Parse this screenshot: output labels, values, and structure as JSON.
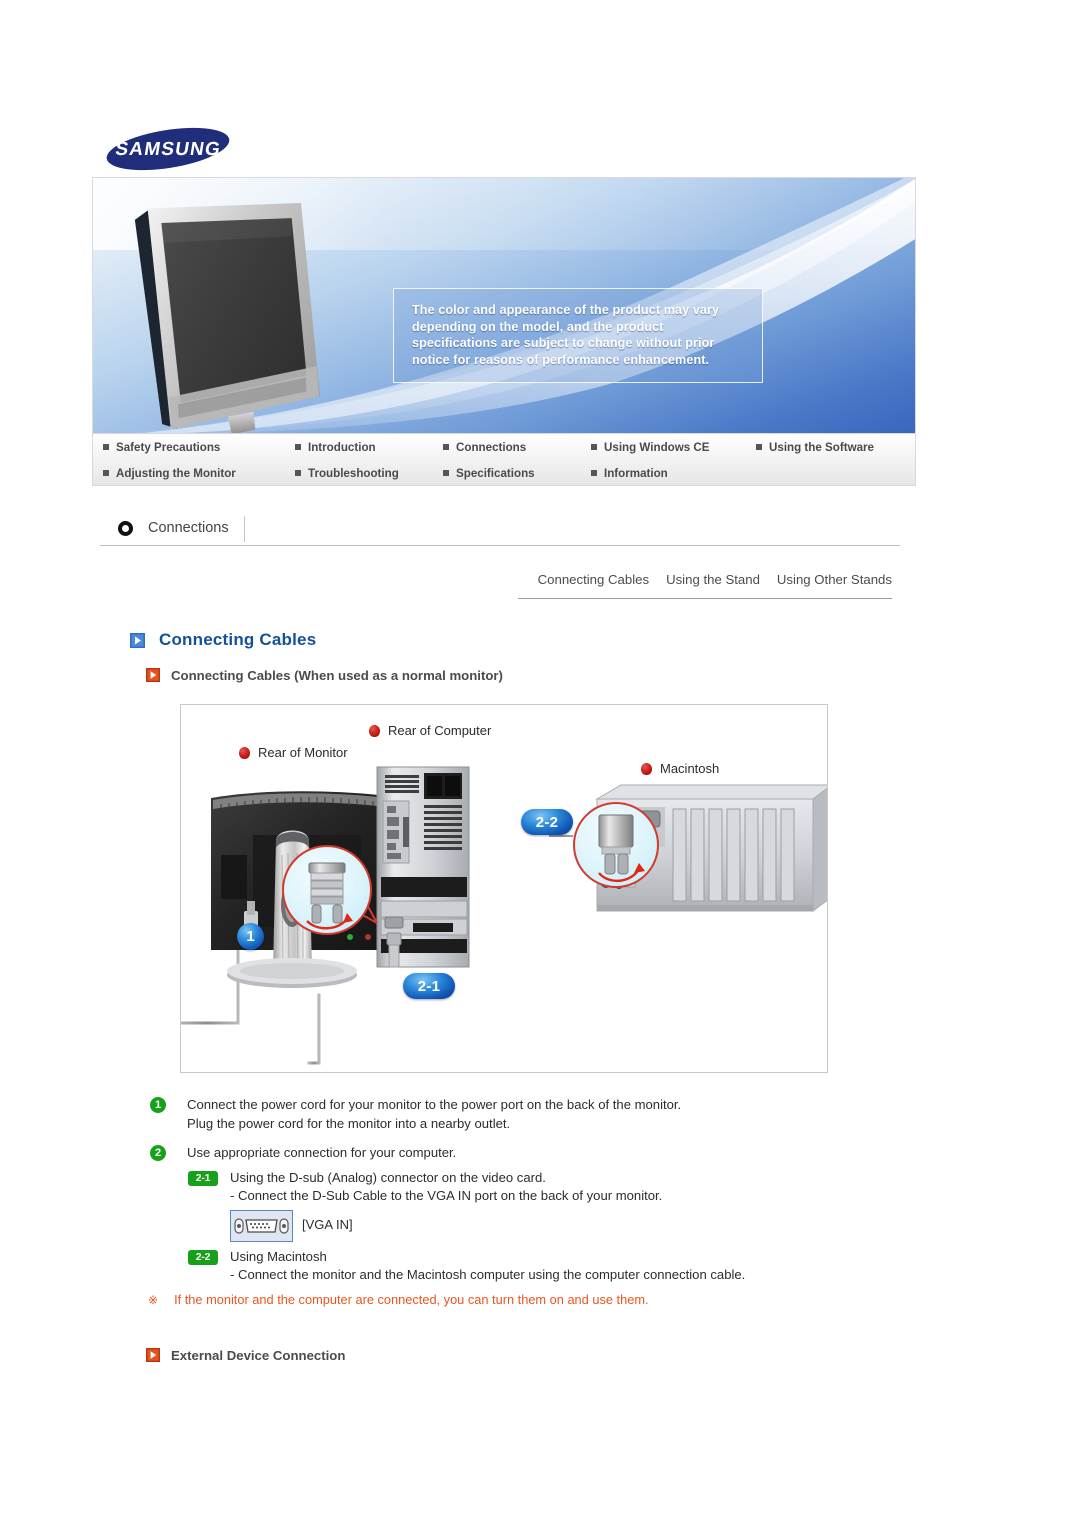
{
  "brand": {
    "logo_text": "SAMSUNG"
  },
  "hero": {
    "disclaimer": "The color and appearance of the product may vary depending on the model, and the product specifications are subject to change without prior notice for reasons of performance enhancement."
  },
  "topnav": {
    "row1": [
      {
        "label": "Safety Precautions"
      },
      {
        "label": "Introduction"
      },
      {
        "label": "Connections"
      },
      {
        "label": "Using Windows CE"
      },
      {
        "label": "Using the Software"
      }
    ],
    "row2": [
      {
        "label": "Adjusting the Monitor"
      },
      {
        "label": "Troubleshooting"
      },
      {
        "label": "Specifications"
      },
      {
        "label": "Information"
      }
    ]
  },
  "section": {
    "title": "Connections"
  },
  "subtabs": [
    {
      "label": "Connecting Cables"
    },
    {
      "label": "Using the Stand"
    },
    {
      "label": "Using Other Stands"
    }
  ],
  "headings": {
    "h1": "Connecting Cables",
    "h2": "Connecting Cables (When used as a normal monitor)",
    "h3": "External Device Connection"
  },
  "diagram": {
    "labels": {
      "monitor": "Rear of Monitor",
      "computer": "Rear of Computer",
      "macintosh": "Macintosh"
    },
    "badges": {
      "one": "1",
      "two_one": "2-1",
      "two_two": "2-2"
    }
  },
  "instructions": {
    "step1": {
      "number": "1",
      "line1": "Connect the power cord for your monitor to the power port on the back of the monitor.",
      "line2": "Plug the power cord for the monitor into a nearby outlet."
    },
    "step2": {
      "number": "2",
      "line1": "Use appropriate connection for your computer."
    },
    "sub21": {
      "number": "2-1",
      "line1": "Using the D-sub (Analog) connector on the video card.",
      "line2": "- Connect the D-Sub Cable to the VGA IN port on the back of your monitor."
    },
    "vga": {
      "caption": "[VGA IN]"
    },
    "sub22": {
      "number": "2-2",
      "line1": "Using Macintosh",
      "line2": "- Connect the monitor and the Macintosh computer using the computer connection cable."
    },
    "note": {
      "mark": "※",
      "text": "If the monitor and the computer are connected, you can turn them on and use them."
    }
  },
  "colors": {
    "brand_navy": "#1f2d7a",
    "heading_blue": "#15509c",
    "accent_red": "#d8441c",
    "note_orange": "#ea5620",
    "badge_blue": "#0f55b5",
    "step_green": "#17a01a"
  }
}
